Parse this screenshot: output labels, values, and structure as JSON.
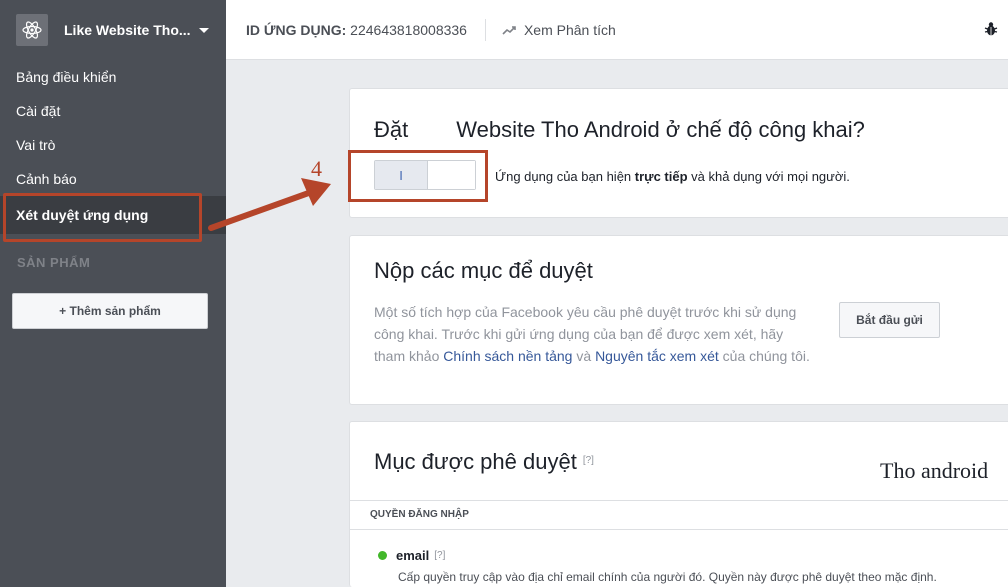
{
  "app": {
    "title": "Like Website Tho...",
    "id_label": "ID ỨNG DỤNG:",
    "id_value": "224643818008336",
    "analytics_label": "Xem Phân tích"
  },
  "sidebar": {
    "items": [
      {
        "label": "Bảng điều khiển"
      },
      {
        "label": "Cài đặt"
      },
      {
        "label": "Vai trò"
      },
      {
        "label": "Cảnh báo"
      },
      {
        "label": "Xét duyệt ứng dụng"
      }
    ],
    "section_label": "SẢN PHẨM",
    "add_product_label": "+ Thêm sản phẩm"
  },
  "public_card": {
    "title_prefix": "Đặt",
    "title_rest": "Website Tho Android ở chế độ công khai?",
    "toggle_on_label": "I",
    "status_prefix": "Ứng dụng của bạn hiện ",
    "status_bold": "trực tiếp",
    "status_suffix": " và khả dụng với mọi người."
  },
  "submit_card": {
    "title": "Nộp các mục để duyệt",
    "desc_1": "Một số tích hợp của Facebook yêu cầu phê duyệt trước khi sử dụng công khai. Trước khi gửi ứng dụng của bạn để được xem xét, hãy tham khảo ",
    "link_1": "Chính sách nền tảng",
    "desc_2": " và ",
    "link_2": "Nguyên tắc xem xét",
    "desc_3": " của chúng tôi.",
    "start_button_label": "Bắt đầu gửi"
  },
  "approved_card": {
    "title": "Mục được phê duyệt",
    "help_mark": "[?]",
    "sub_header": "QUYỀN ĐĂNG NHẬP",
    "permission": {
      "name": "email",
      "help_mark": "[?]",
      "description": "Cấp quyền truy cập vào địa chỉ email chính của người đó. Quyền này được phê duyệt theo mặc định.",
      "status_color": "#42b72a"
    }
  },
  "annotations": {
    "step_number": "4",
    "handwritten_label": "Tho android",
    "highlight_color": "#b5452a"
  }
}
